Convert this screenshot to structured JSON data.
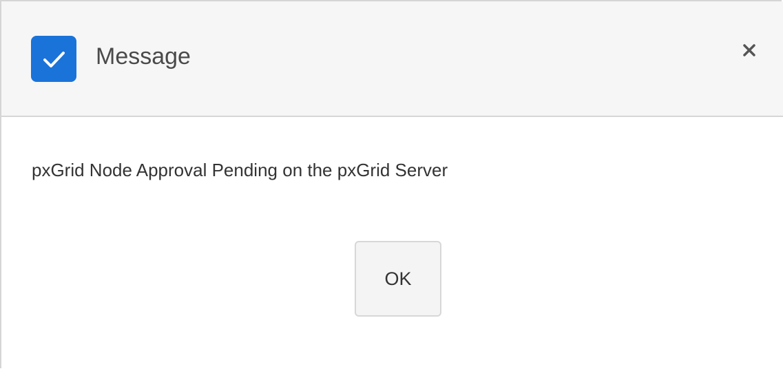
{
  "dialog": {
    "title": "Message",
    "header_icon": "checkbox-checked-icon",
    "close_icon": "close-icon",
    "message": "pxGrid Node Approval Pending on the pxGrid Server",
    "ok_label": "OK"
  },
  "colors": {
    "accent": "#1a73d9",
    "header_bg": "#f6f6f6",
    "border": "#d6d6d6",
    "title_text": "#4a4a4a",
    "body_text": "#333333",
    "button_bg": "#f4f4f4"
  }
}
